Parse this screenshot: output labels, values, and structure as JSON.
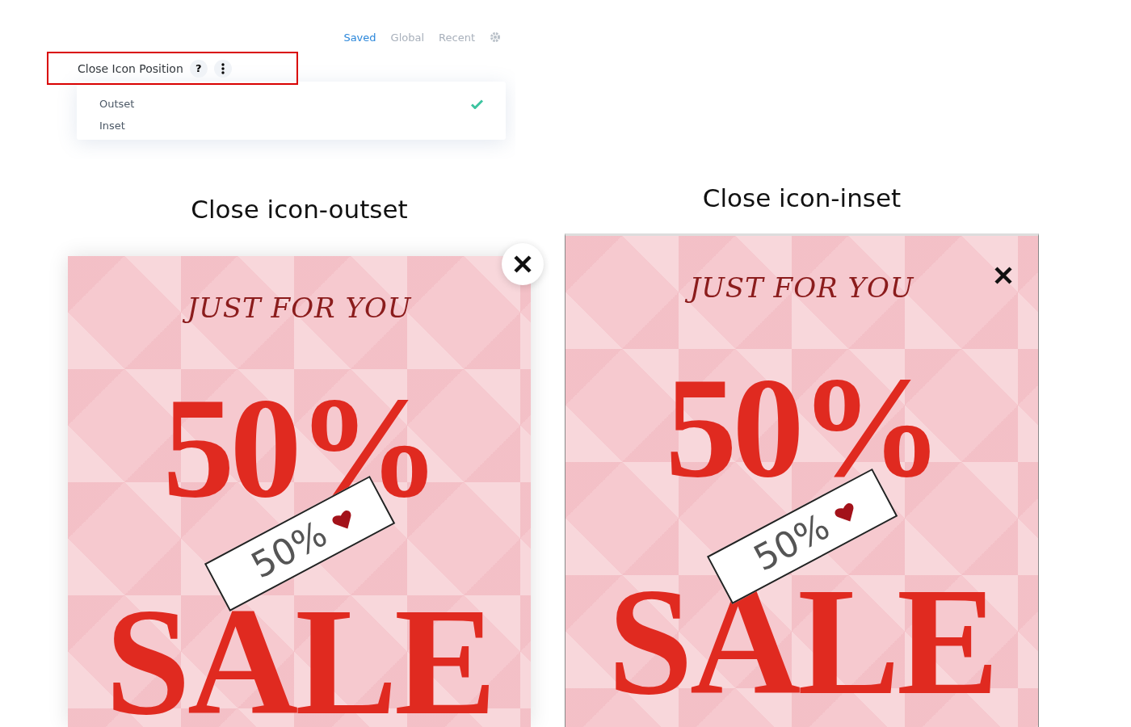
{
  "tabs": [
    {
      "label": "Saved",
      "selected": true
    },
    {
      "label": "Global",
      "selected": false
    },
    {
      "label": "Recent",
      "selected": false
    }
  ],
  "setting": {
    "label": "Close Icon Position",
    "help": "?",
    "highlighted": true,
    "options": [
      {
        "label": "Outset",
        "selected": true
      },
      {
        "label": "Inset",
        "selected": false
      }
    ]
  },
  "previews": [
    {
      "caption": "Close icon-outset",
      "kind": "outset",
      "banner": {
        "headline": "JUST FOR YOU",
        "discount": "50%",
        "word": "SALE",
        "tag": "50%"
      }
    },
    {
      "caption": "Close icon-inset",
      "kind": "inset",
      "banner": {
        "headline": "JUST FOR YOU",
        "discount": "50%",
        "word": "SALE",
        "tag": "50%"
      }
    }
  ]
}
